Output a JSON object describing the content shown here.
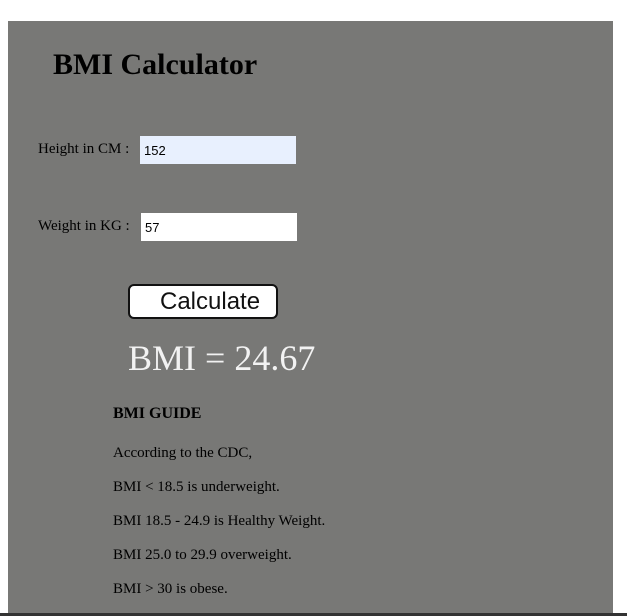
{
  "title": "BMI Calculator",
  "form": {
    "height_label": "Height in CM :",
    "height_value": "152",
    "weight_label": "Weight in KG :",
    "weight_value": "57",
    "calculate_label": "Calculate"
  },
  "result": "BMI = 24.67",
  "guide": {
    "heading": "BMI GUIDE",
    "lines": [
      "According to the CDC,",
      "BMI < 18.5 is underweight.",
      "BMI 18.5 - 24.9 is Healthy Weight.",
      "BMI 25.0 to 29.9 overweight.",
      "BMI > 30 is obese."
    ]
  },
  "colors": {
    "panel": "#787876",
    "height_input_bg": "#e8f0fe",
    "result_text": "#f2f2f2"
  }
}
